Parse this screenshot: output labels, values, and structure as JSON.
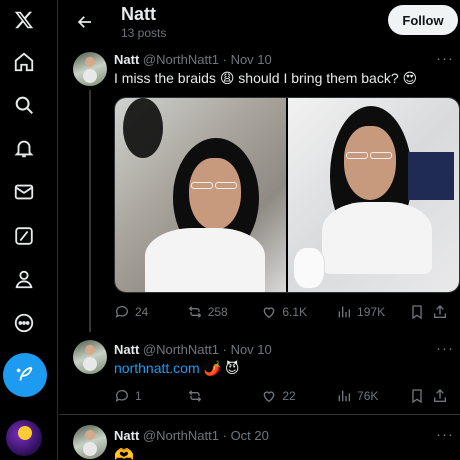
{
  "nav": {
    "items": [
      "x-logo-icon",
      "home-icon",
      "search-icon",
      "notifications-icon",
      "messages-icon",
      "grok-icon",
      "profile-icon",
      "more-icon"
    ],
    "post_button": "post-icon"
  },
  "header": {
    "title": "Natt",
    "subtitle": "13 posts",
    "follow_label": "Follow"
  },
  "tweets": [
    {
      "name": "Natt",
      "handle": "@NorthNatt1",
      "dot": "·",
      "date": "Nov 10",
      "text": "I miss the braids 😩 should I bring them back? 😍",
      "more": "···",
      "stats": {
        "replies": "24",
        "retweets": "258",
        "likes": "6.1K",
        "views": "197K"
      }
    },
    {
      "name": "Natt",
      "handle": "@NorthNatt1",
      "dot": "·",
      "date": "Nov 10",
      "link": "northnatt.com",
      "text_after": " 🌶️ 😈",
      "more": "···",
      "stats": {
        "replies": "1",
        "retweets": "",
        "likes": "22",
        "views": "76K"
      }
    },
    {
      "name": "Natt",
      "handle": "@NorthNatt1",
      "dot": "·",
      "date": "Oct 20",
      "text": "🫶",
      "more": "···"
    }
  ],
  "colors": {
    "accent": "#1d9bf0",
    "muted": "#71767b",
    "border": "#2f3336",
    "background": "#000000"
  }
}
